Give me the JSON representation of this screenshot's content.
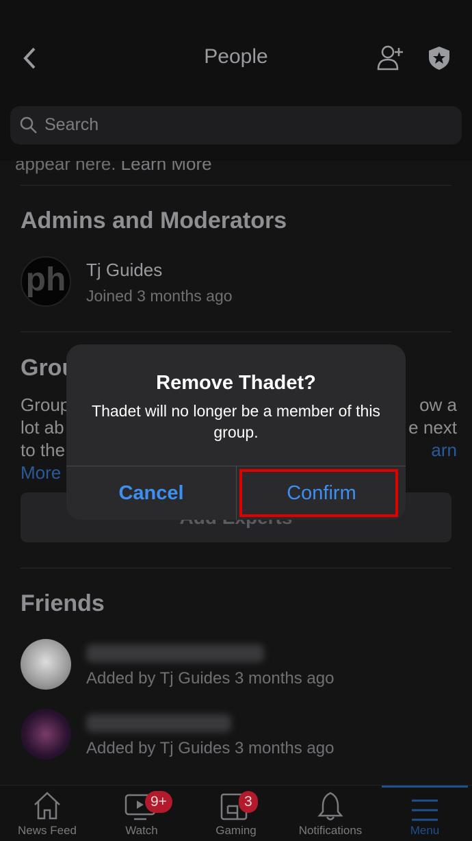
{
  "header": {
    "title": "People"
  },
  "search": {
    "placeholder": "Search"
  },
  "top_text": {
    "prefix": "appear here. ",
    "link": "Learn More"
  },
  "admins": {
    "heading": "Admins and Moderators",
    "members": [
      {
        "name": "Tj Guides",
        "sub": "Joined 3 months ago"
      }
    ]
  },
  "group_fragments": {
    "heading": "Grou",
    "l1a": "Group",
    "l1b": "ow a",
    "l2a": "lot ab",
    "l2b": "e next",
    "l3a": "to the",
    "l3b": "arn",
    "l4": "More"
  },
  "add_experts": "Add Experts",
  "friends": {
    "heading": "Friends",
    "items": [
      {
        "sub": "Added by Tj Guides 3 months ago"
      },
      {
        "sub": "Added by Tj Guides 3 months ago"
      }
    ]
  },
  "dialog": {
    "title": "Remove Thadet?",
    "message": "Thadet will no longer be a member of this group.",
    "cancel": "Cancel",
    "confirm": "Confirm",
    "highlight_color": "#e00000"
  },
  "nav": {
    "items": [
      {
        "label": "News Feed"
      },
      {
        "label": "Watch",
        "badge": "9+"
      },
      {
        "label": "Gaming",
        "badge": "3"
      },
      {
        "label": "Notifications"
      },
      {
        "label": "Menu",
        "active": true
      }
    ],
    "active_color": "#1d4f91"
  }
}
